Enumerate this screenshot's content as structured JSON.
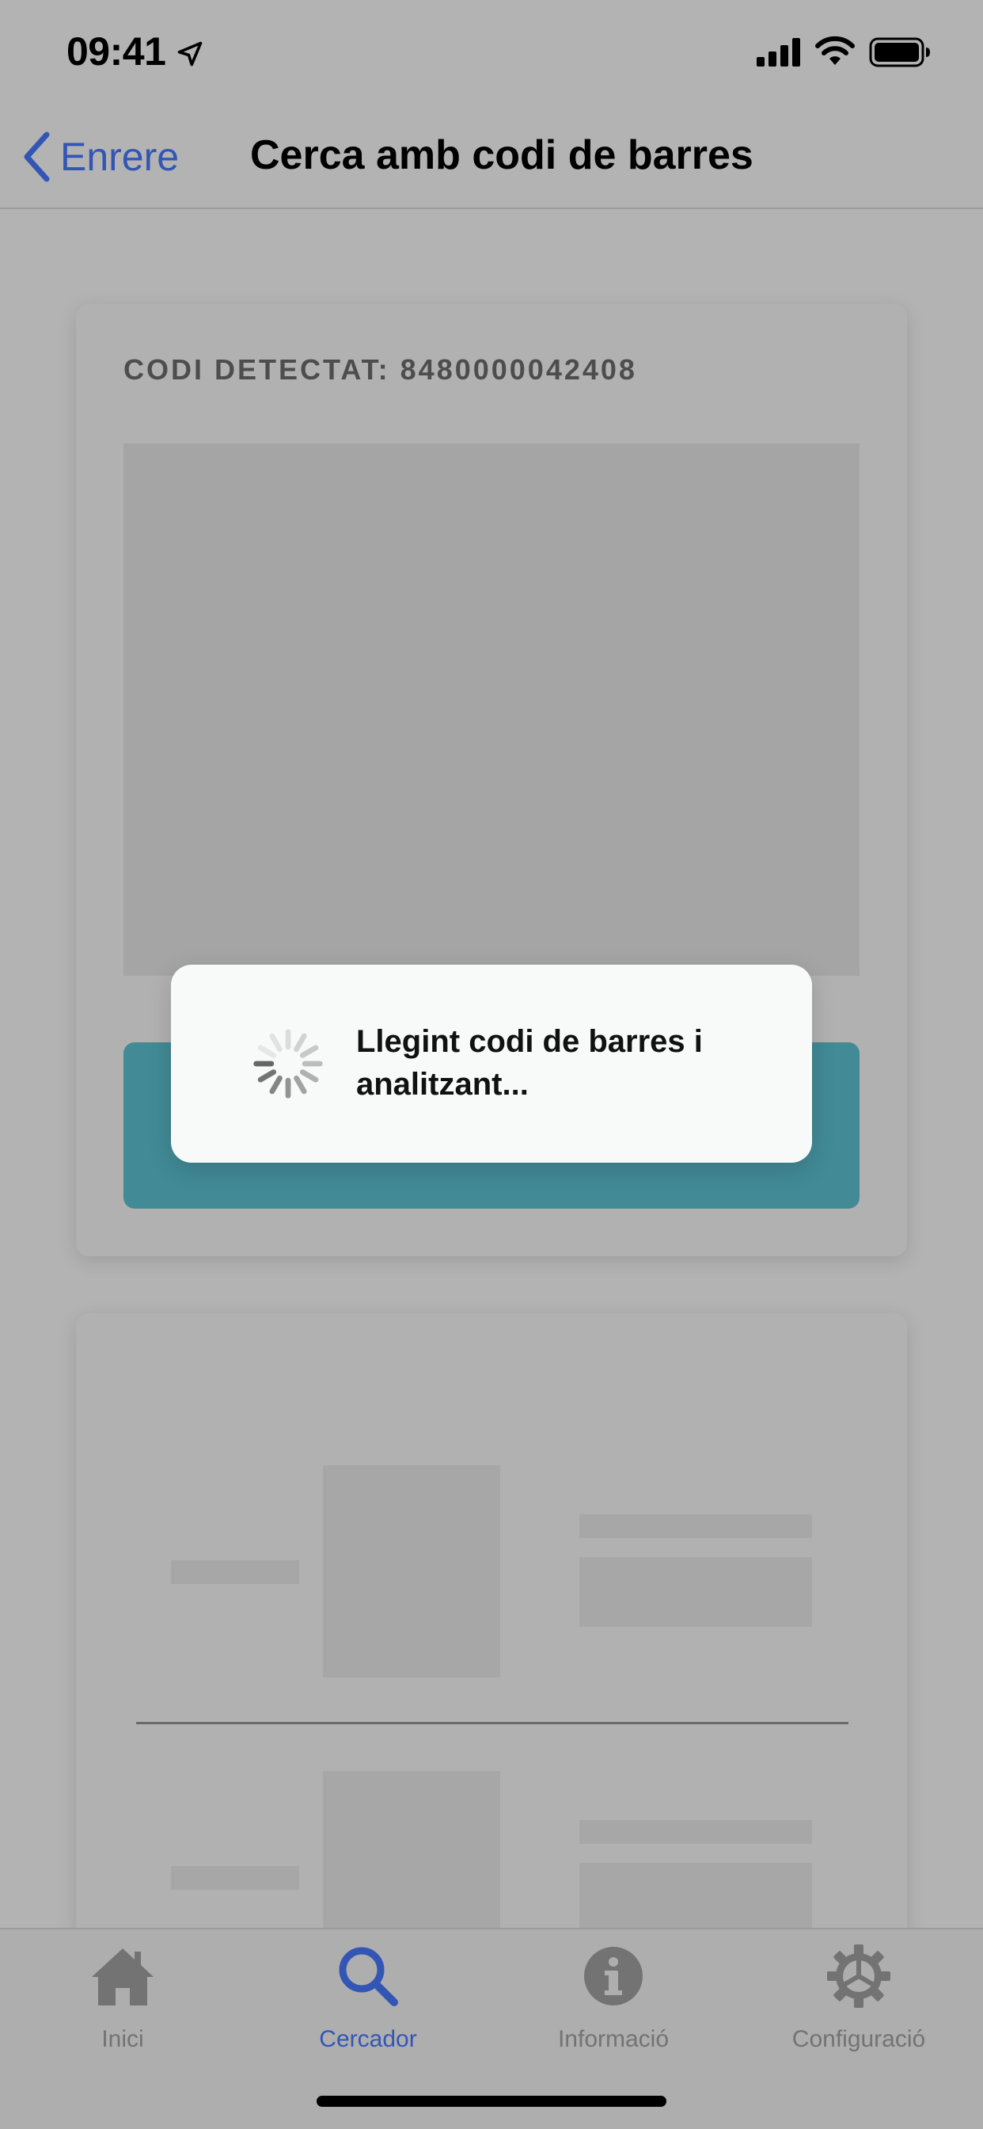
{
  "status_bar": {
    "time": "09:41"
  },
  "nav": {
    "back_label": "Enrere",
    "title": "Cerca amb codi de barres"
  },
  "scan_card": {
    "detected_label": "CODI DETECTAT: 8480000042408"
  },
  "loading": {
    "message": "Llegint codi de barres i analitzant..."
  },
  "tab_bar": {
    "items": [
      {
        "label": "Inici",
        "icon": "home-icon"
      },
      {
        "label": "Cercador",
        "icon": "search-icon",
        "active": true
      },
      {
        "label": "Informació",
        "icon": "info-icon"
      },
      {
        "label": "Configuració",
        "icon": "gear-icon"
      }
    ]
  },
  "colors": {
    "accent": "#3356b5",
    "action_button": "#418a96",
    "overlay_background": "#b3b3b3",
    "modal_background": "#f8f9f9"
  }
}
